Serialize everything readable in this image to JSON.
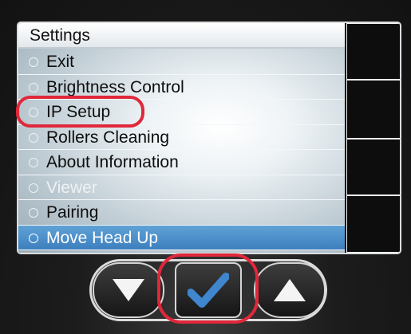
{
  "menu": {
    "title": "Settings",
    "items": [
      {
        "label": "Exit",
        "state": "normal"
      },
      {
        "label": "Brightness Control",
        "state": "normal"
      },
      {
        "label": "IP Setup",
        "state": "normal"
      },
      {
        "label": "Rollers Cleaning",
        "state": "normal"
      },
      {
        "label": "About Information",
        "state": "normal"
      },
      {
        "label": "Viewer",
        "state": "disabled"
      },
      {
        "label": "Pairing",
        "state": "normal"
      },
      {
        "label": "Move Head Up",
        "state": "selected"
      }
    ]
  },
  "controls": {
    "down": "arrow-down-icon",
    "ok": "checkmark-icon",
    "up": "arrow-up-icon"
  },
  "annotations": {
    "highlight_color": "#e0283a"
  },
  "colors": {
    "selected_row": "#4a8ccb",
    "checkmark": "#3f86cf"
  }
}
